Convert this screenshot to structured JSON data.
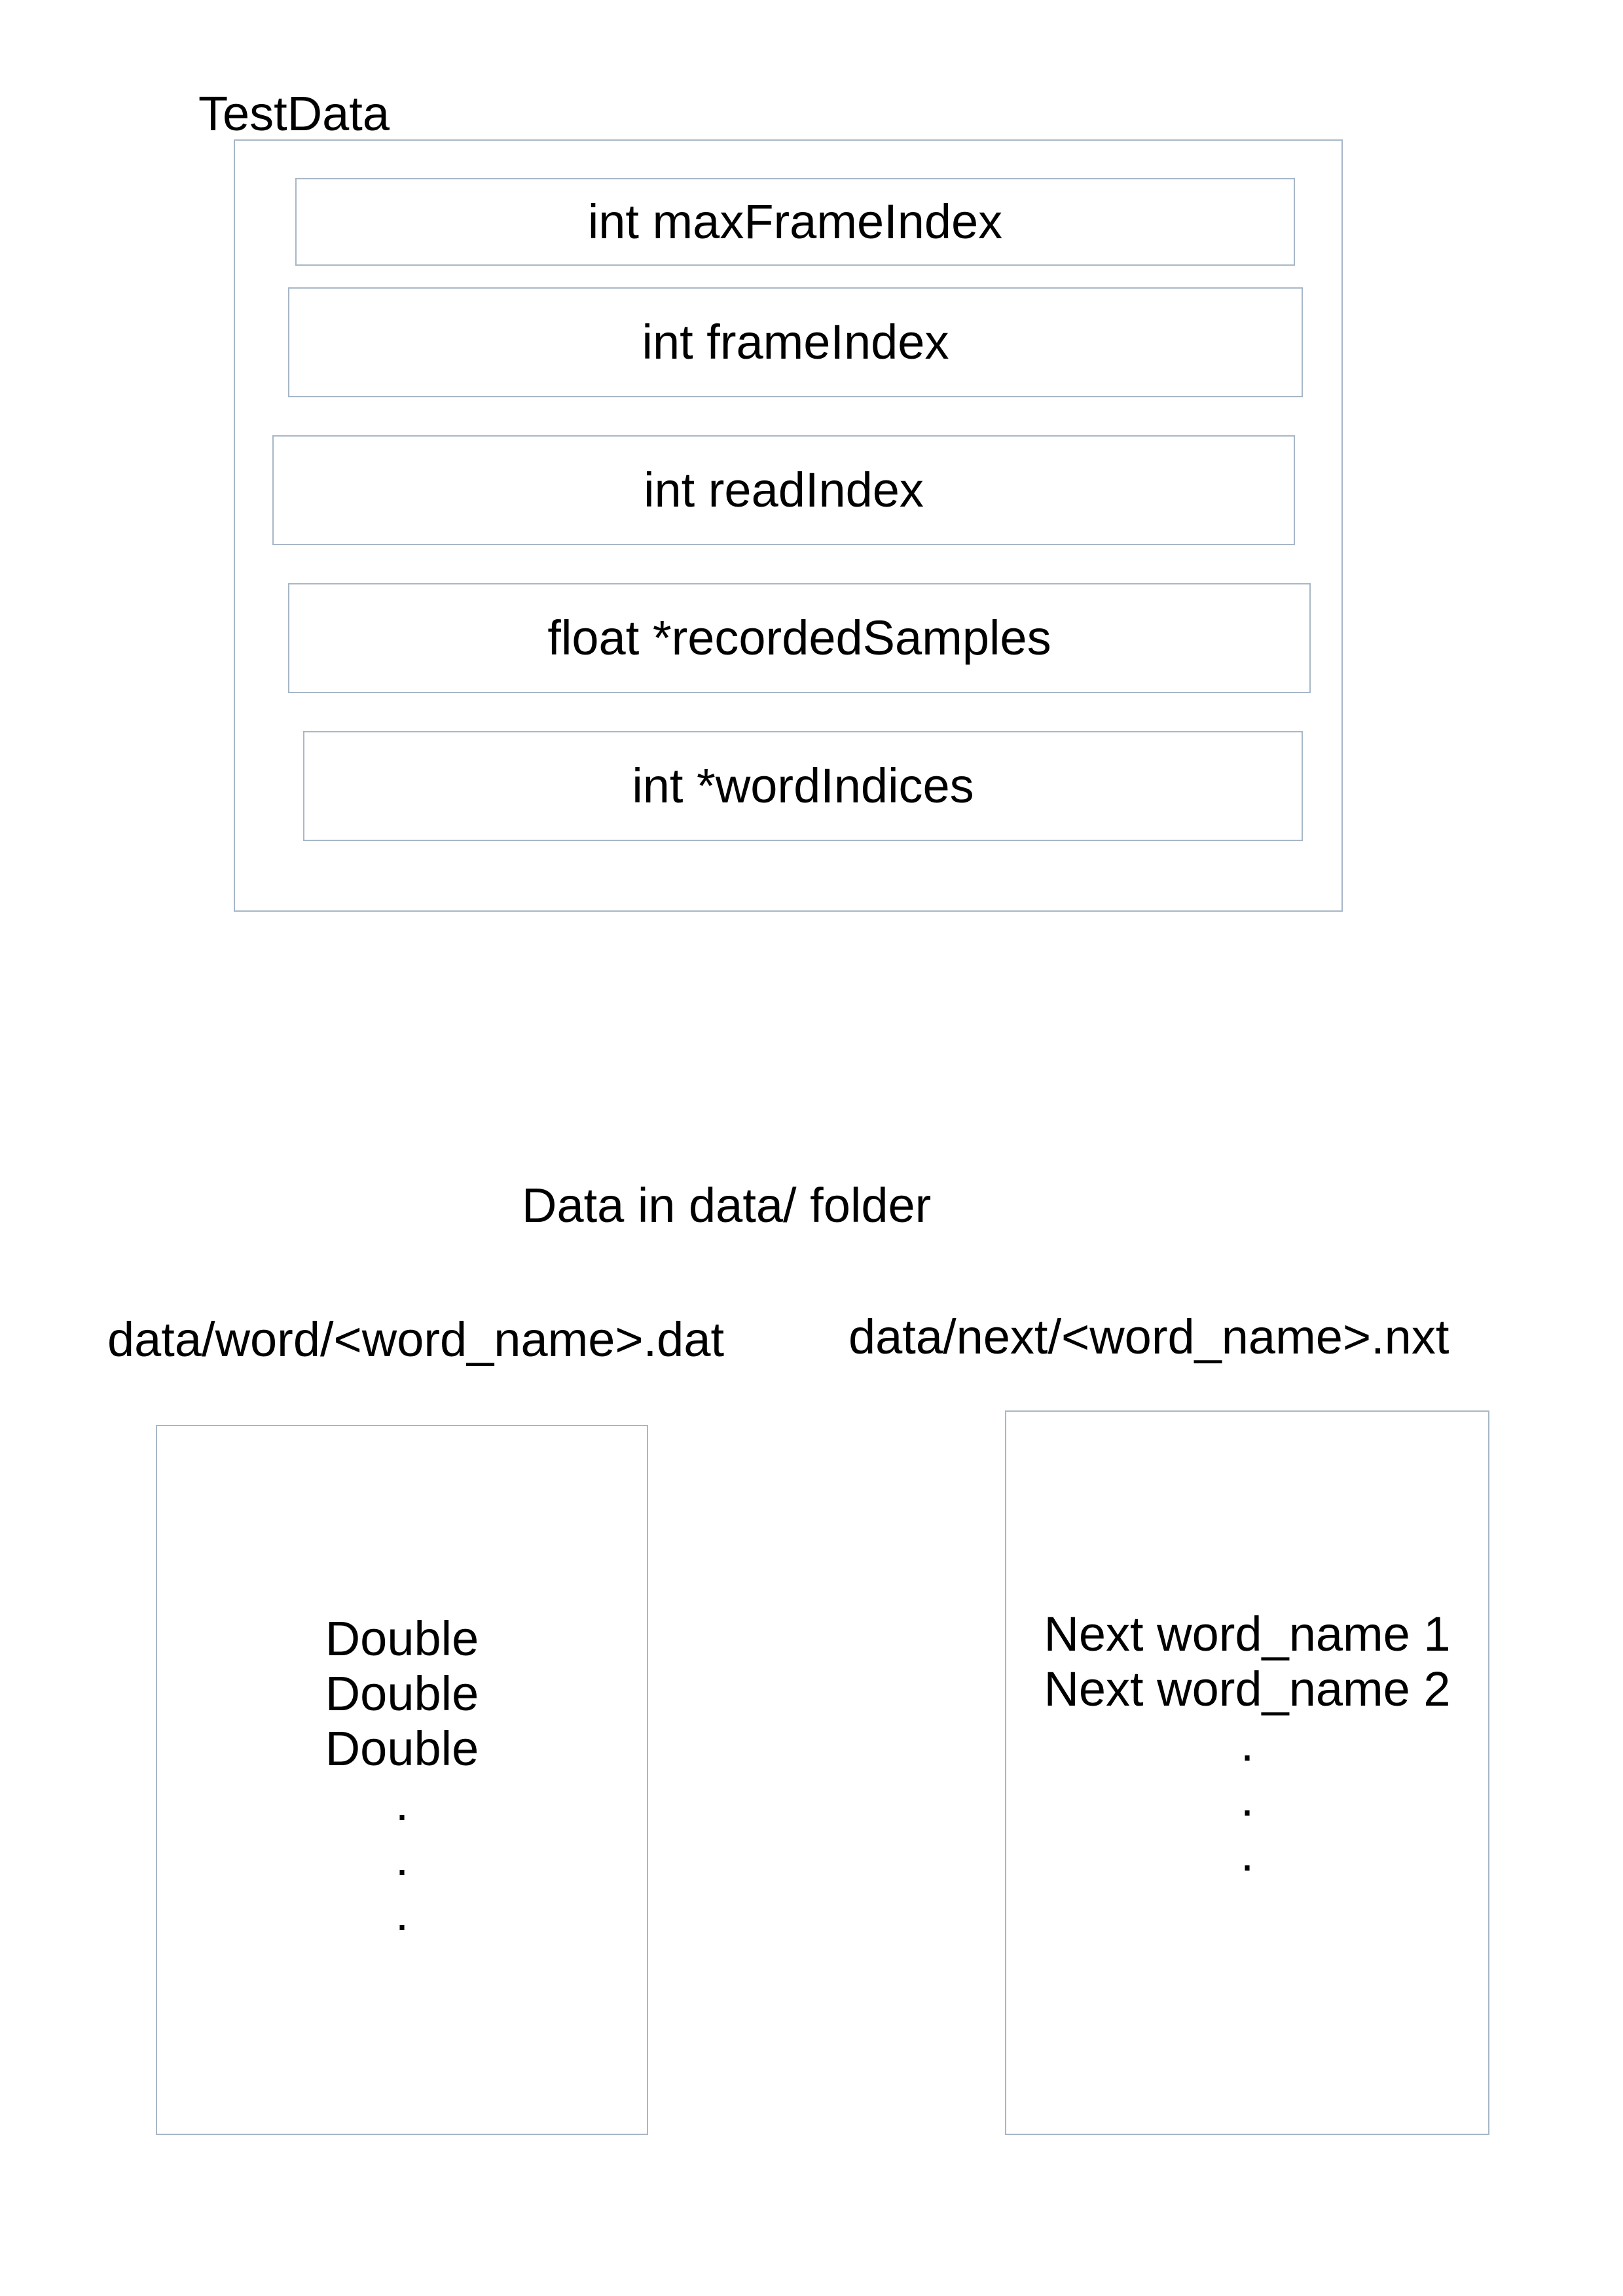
{
  "struct": {
    "title": "TestData",
    "fields": [
      "int maxFrameIndex",
      "int frameIndex",
      "int readIndex",
      "float *recordedSamples",
      "int *wordIndices"
    ]
  },
  "data_section": {
    "title": "Data in data/ folder",
    "word_file": {
      "path": "data/word/<word_name>.dat",
      "lines": [
        "Double",
        "Double",
        "Double"
      ],
      "continuation": [
        "."
      ]
    },
    "next_file": {
      "path": "data/next/<word_name>.nxt",
      "lines": [
        "Next word_name 1",
        "Next word_name 2"
      ],
      "continuation": [
        "."
      ]
    }
  },
  "colors": {
    "border": "#a7b7c7",
    "text": "#000000",
    "background": "#ffffff"
  }
}
